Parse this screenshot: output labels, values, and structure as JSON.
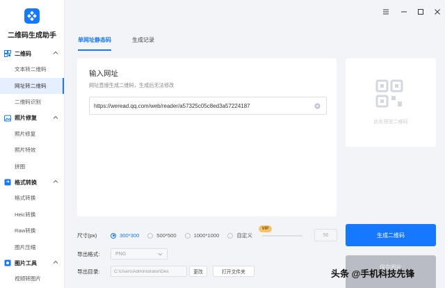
{
  "app": {
    "name": "二维码生成助手"
  },
  "sidebar": {
    "sections": [
      {
        "title": "二维码",
        "items": [
          "文本转二维码",
          "网址转二维码",
          "二维码识别"
        ]
      },
      {
        "title": "照片修复",
        "items": [
          "照片修复",
          "照片特效",
          "拼图"
        ]
      },
      {
        "title": "格式转换",
        "items": [
          "格式转换",
          "Heic转换",
          "Raw转换",
          "图片压缩"
        ]
      },
      {
        "title": "图片工具",
        "items": [
          "视频转图片"
        ]
      }
    ],
    "active_item": "网址转二维码"
  },
  "tabs": [
    "单网址静态码",
    "生成记录"
  ],
  "form": {
    "title": "输入网址",
    "hint": "网址直接生成二维码，生成后无法修改",
    "url_value": "https://weread.qq.com/web/reader/a57325c05c8ed3a57224187"
  },
  "preview": {
    "text": "此处预览二维码"
  },
  "size": {
    "label": "尺寸(px)",
    "options": [
      "300*300",
      "500*500",
      "1000*1000",
      "自定义"
    ],
    "selected": "300*300",
    "vip": "VIP",
    "custom_value": "50"
  },
  "format": {
    "label": "导出格式:",
    "value": "PNG"
  },
  "dir": {
    "label": "导出目录:",
    "path": "C:\\Users\\Administrator\\Des",
    "change": "更改",
    "open": "打开文件夹"
  },
  "buttons": {
    "generate": "生成二维码",
    "save": "保存图片"
  },
  "watermark": "头条 @手机科技先锋",
  "colors": {
    "accent": "#1677ff"
  }
}
